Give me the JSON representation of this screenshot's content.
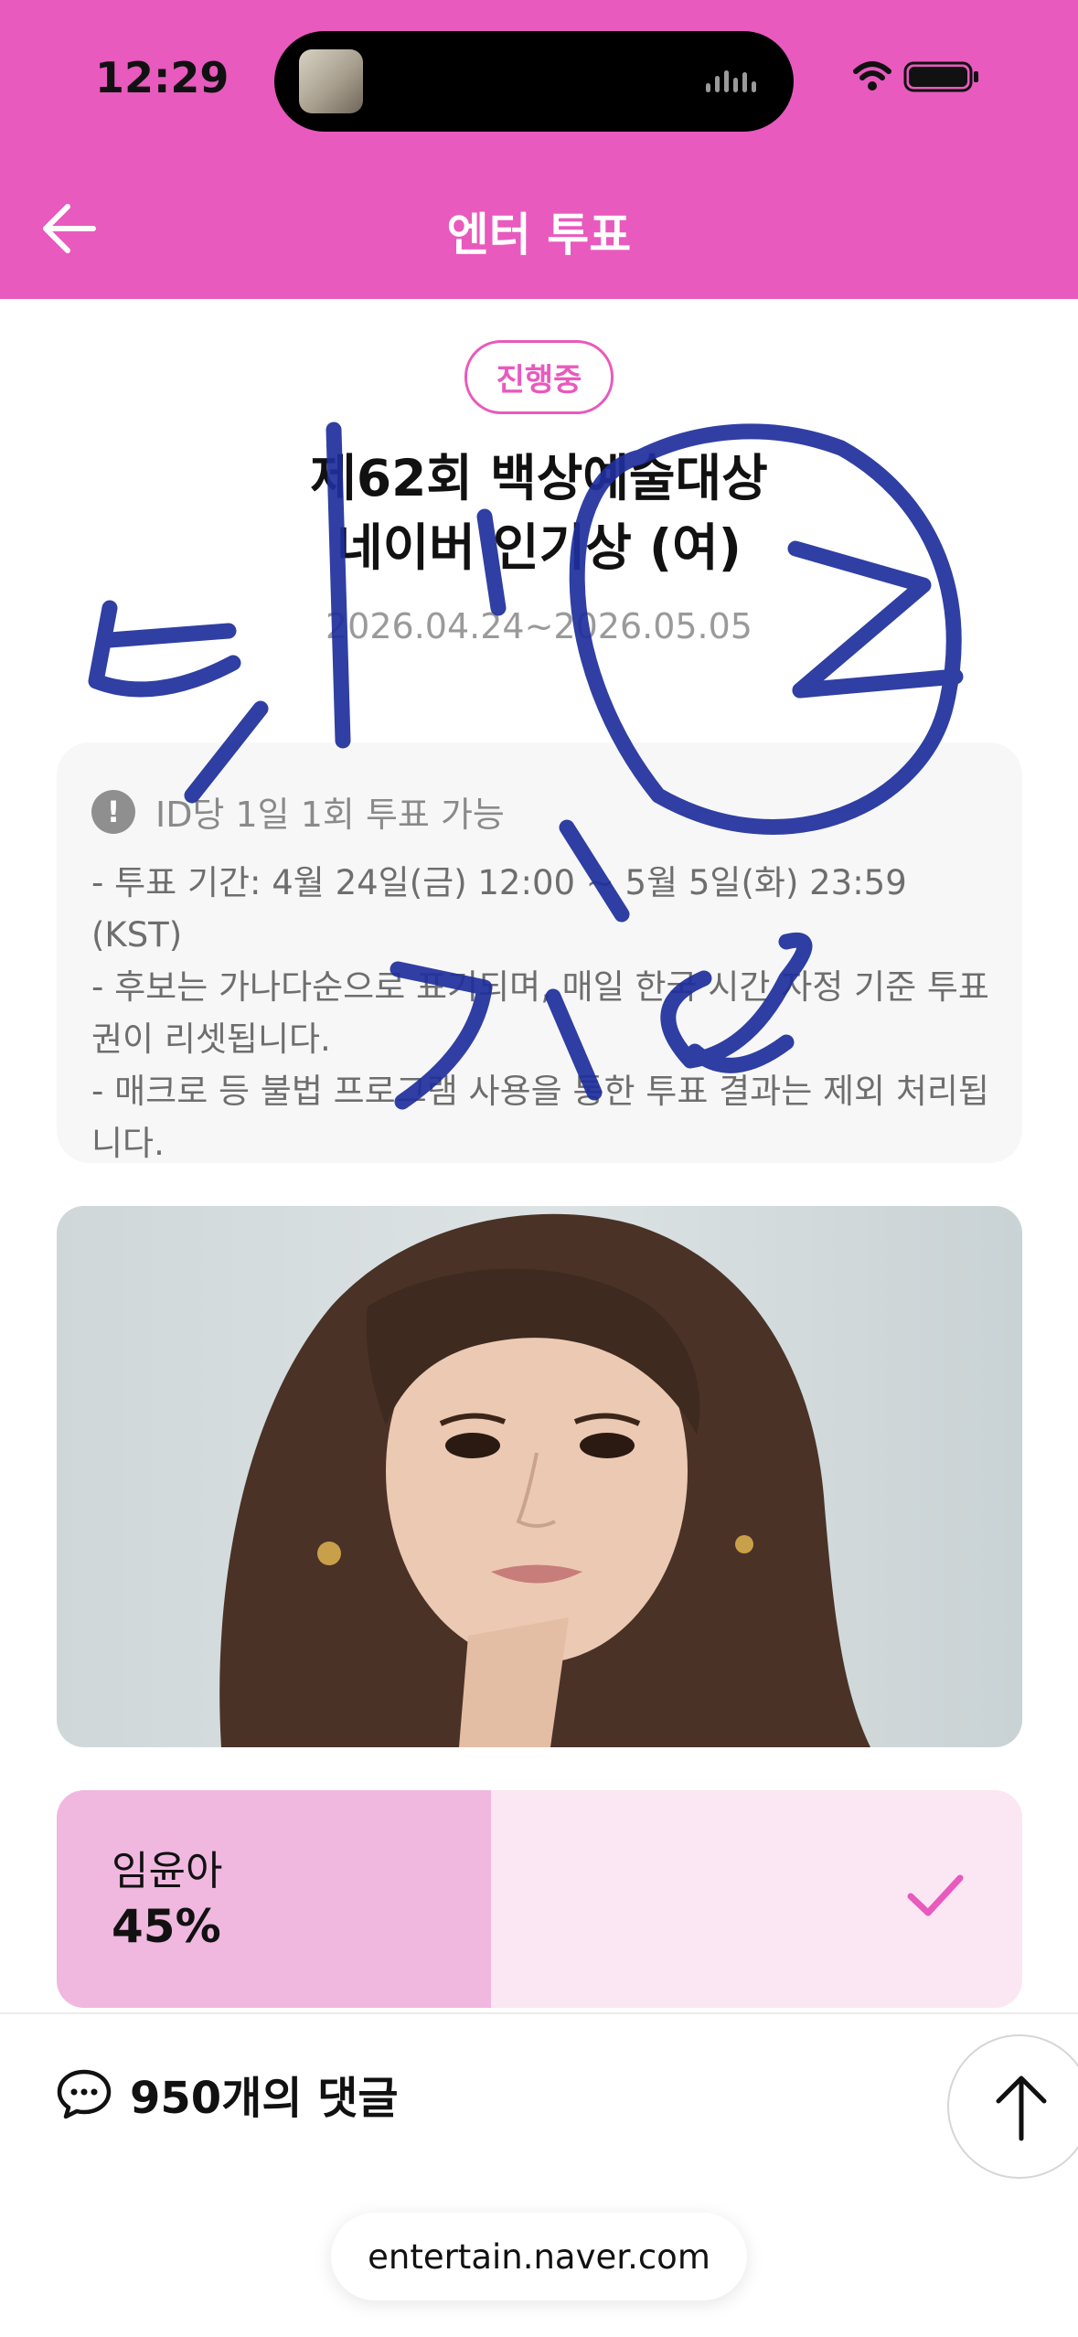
{
  "status_bar": {
    "time": "12:29"
  },
  "header": {
    "title": "엔터 투표"
  },
  "vote_event": {
    "status_badge": "진행중",
    "title_line1": "제62회 백상예술대상",
    "title_line2": "네이버 인기상 (여)",
    "period": "2026.04.24~2026.05.05"
  },
  "notice": {
    "title": "ID당 1일 1회 투표 가능",
    "lines": [
      "- 투표 기간: 4월 24일(금) 12:00 ~ 5월 5일(화) 23:59 (KST)",
      "- 후보는 가나다순으로 표기되며, 매일 한국 시간 자정 기준 투표권이 리셋됩니다.",
      "- 매크로 등 불법 프로그램 사용을 통한 투표 결과는 제외 처리됩니다."
    ]
  },
  "candidate": {
    "name": "임윤아",
    "percent_label": "45%",
    "percent_value": 45,
    "selected": true
  },
  "comments": {
    "count_label": "950개의 댓글"
  },
  "browser": {
    "url": "entertain.naver.com"
  },
  "colors": {
    "brand_pink": "#e85abd",
    "vote_fill": "#f0b7df",
    "vote_bg": "#fbe6f3",
    "scribble_blue": "#1f2f9c"
  },
  "icons": [
    "back-arrow-icon",
    "wifi-icon",
    "battery-icon",
    "exclamation-icon",
    "checkmark-icon",
    "comment-bubble-icon",
    "arrow-up-icon"
  ]
}
